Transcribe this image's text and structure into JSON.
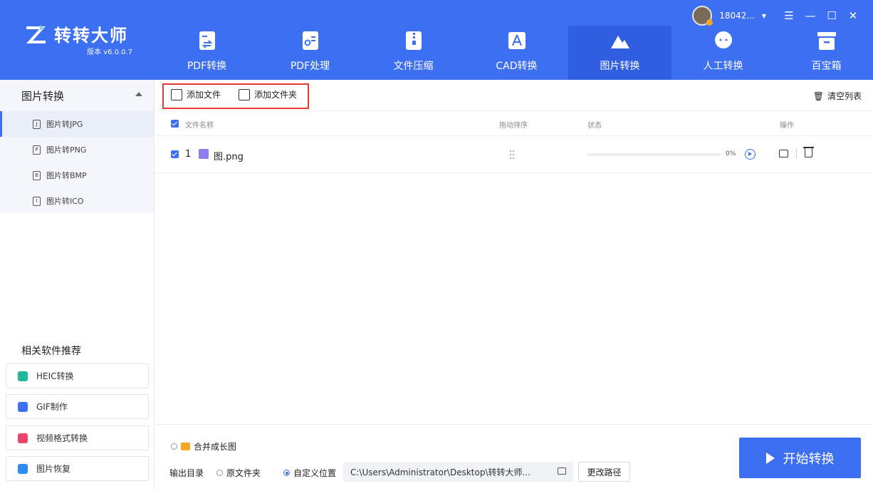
{
  "app": {
    "name": "转转大师",
    "version": "版本 v6.0.0.7",
    "user": "18042...",
    "accent_color": "#3d6ff2"
  },
  "nav": [
    {
      "label": "PDF转换",
      "icon": "pdf-convert-icon",
      "active": false
    },
    {
      "label": "PDF处理",
      "icon": "pdf-process-icon",
      "active": false
    },
    {
      "label": "文件压缩",
      "icon": "zip-icon",
      "active": false
    },
    {
      "label": "CAD转换",
      "icon": "cad-icon",
      "active": false
    },
    {
      "label": "图片转换",
      "icon": "image-icon",
      "active": true
    },
    {
      "label": "人工转换",
      "icon": "chat-icon",
      "active": false
    },
    {
      "label": "百宝箱",
      "icon": "toolbox-icon",
      "active": false
    }
  ],
  "sidebar": {
    "group_title": "图片转换",
    "items": [
      {
        "label": "图片转JPG",
        "icon": "J"
      },
      {
        "label": "图片转PNG",
        "icon": "P"
      },
      {
        "label": "图片转BMP",
        "icon": "B"
      },
      {
        "label": "图片转ICO",
        "icon": "I"
      }
    ],
    "recommend_title": "相关软件推荐",
    "recommend": [
      {
        "label": "HEIC转换",
        "color": "#1fb89a"
      },
      {
        "label": "GIF制作",
        "color": "#3d6ff2"
      },
      {
        "label": "视频格式转换",
        "color": "#f0456a"
      },
      {
        "label": "图片恢复",
        "color": "#2d8cf0"
      }
    ]
  },
  "toolbar": {
    "add_file": "添加文件",
    "add_folder": "添加文件夹",
    "clear_list": "清空列表"
  },
  "table": {
    "headers": {
      "name": "文件名称",
      "sort": "拖动排序",
      "status": "状态",
      "ops": "操作"
    },
    "rows": [
      {
        "index": "1",
        "name": "图.png",
        "progress": 0,
        "progress_text": "0%"
      }
    ]
  },
  "bottom": {
    "merge_label": "合并成长图",
    "output_label": "输出目录",
    "opt_original": "原文件夹",
    "opt_custom": "自定义位置",
    "path": "C:\\Users\\Administrator\\Desktop\\转转大师...",
    "change_path": "更改路径",
    "start": "开始转换"
  }
}
